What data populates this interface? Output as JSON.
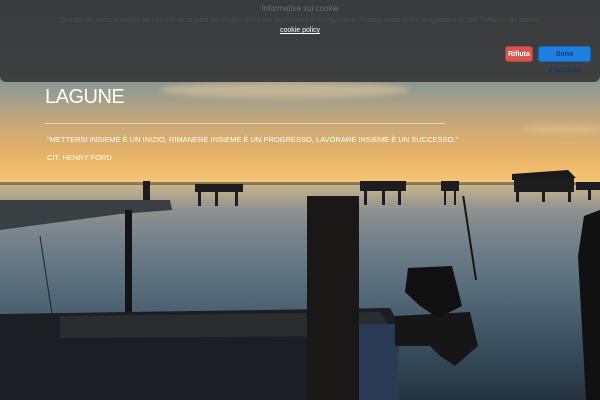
{
  "cookie_banner": {
    "title": "Informativa sui cookie",
    "text": "Questo sito utilizza cookie tecnici e di terze parti per migliorare la tua esperienza di navigazione. Proseguendo nella navigazione accetti l'utilizzo dei cookie.",
    "policy_link": "cookie policy",
    "refuse_label": "Rifiuta",
    "accept_label": "Sono d'accordo"
  },
  "hero": {
    "title": "LAGUNE",
    "quote": "\"METTERSI INSIEME È UN INIZIO, RIMANERE INSIEME È UN PROGRESSO, LAVORARE INSIEME È UN SUCCESSO.\"",
    "citation": "CIT. HENRY FORD"
  },
  "colors": {
    "banner_bg": "#3a3a3a",
    "refuse_button": "#d9534f",
    "accept_button": "#1e7fe0",
    "text": "#ffffff"
  }
}
